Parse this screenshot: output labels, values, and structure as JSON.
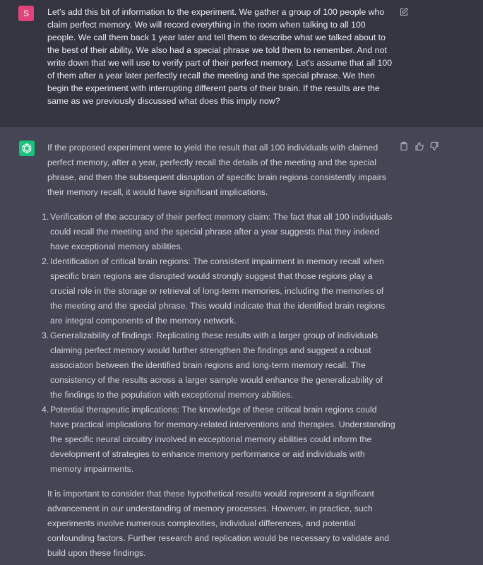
{
  "user": {
    "avatar_initial": "S",
    "message": "Let's add this bit of information to the experiment. We gather a group of 100 people who claim perfect memory. We will record everything in the room when talking to all 100 people. We call them back 1 year later and tell them to describe what we talked about to the best of their ability. We also had a special phrase we told them to remember. And not write down that we will use to verify part of their perfect memory. Let's assume that all 100 of them after a year later perfectly recall the meeting and the special phrase. We then begin the experiment with interrupting different parts of their brain. If the results are the same as we previously discussed what does this imply now?"
  },
  "assistant": {
    "intro": "If the proposed experiment were to yield the result that all 100 individuals with claimed perfect memory, after a year, perfectly recall the details of the meeting and the special phrase, and then the subsequent disruption of specific brain regions consistently impairs their memory recall, it would have significant implications.",
    "items": [
      {
        "num": "1.",
        "text": "Verification of the accuracy of their perfect memory claim: The fact that all 100 individuals could recall the meeting and the special phrase after a year suggests that they indeed have exceptional memory abilities."
      },
      {
        "num": "2.",
        "text": "Identification of critical brain regions: The consistent impairment in memory recall when specific brain regions are disrupted would strongly suggest that those regions play a crucial role in the storage or retrieval of long-term memories, including the memories of the meeting and the special phrase. This would indicate that the identified brain regions are integral components of the memory network."
      },
      {
        "num": "3.",
        "text": "Generalizability of findings: Replicating these results with a larger group of individuals claiming perfect memory would further strengthen the findings and suggest a robust association between the identified brain regions and long-term memory recall. The consistency of the results across a larger sample would enhance the generalizability of the findings to the population with exceptional memory abilities."
      },
      {
        "num": "4.",
        "text": "Potential therapeutic implications: The knowledge of these critical brain regions could have practical implications for memory-related interventions and therapies. Understanding the specific neural circuitry involved in exceptional memory abilities could inform the development of strategies to enhance memory performance or aid individuals with memory impairments."
      }
    ],
    "conclusion": "It is important to consider that these hypothetical results would represent a significant advancement in our understanding of memory processes. However, in practice, such experiments involve numerous complexities, individual differences, and potential confounding factors. Further research and replication would be necessary to validate and build upon these findings."
  },
  "icons": {
    "edit": "edit-icon",
    "copy": "clipboard-icon",
    "thumbs_up": "thumbs-up-icon",
    "thumbs_down": "thumbs-down-icon",
    "assistant_logo": "openai-logo-icon"
  },
  "colors": {
    "user_bg": "#343541",
    "assistant_bg": "#444654",
    "user_avatar": "#e0447a",
    "assistant_avatar": "#19c37d"
  }
}
